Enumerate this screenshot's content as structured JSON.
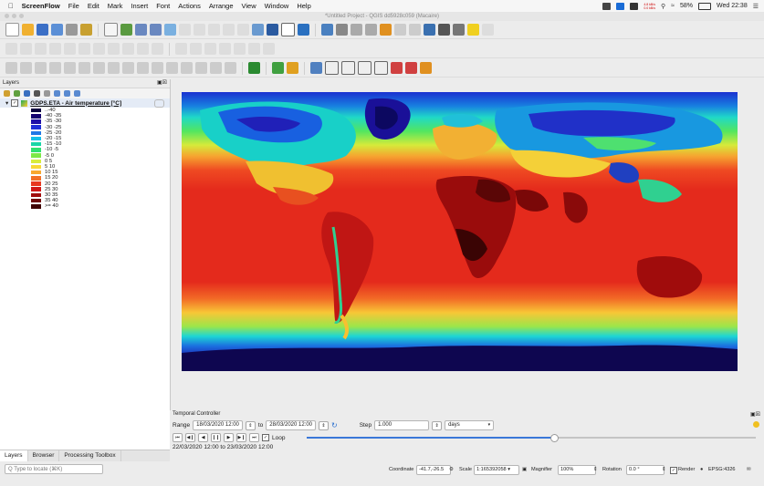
{
  "menubar": {
    "app": "ScreenFlow",
    "items": [
      "File",
      "Edit",
      "Mark",
      "Insert",
      "Font",
      "Actions",
      "Arrange",
      "View",
      "Window",
      "Help"
    ],
    "battery": "58%",
    "clock": "Wed 22:38",
    "net_up": "4.8 kB/s",
    "net_down": "0.0 kB/s"
  },
  "window": {
    "title": "*Untitled Project - QGIS dd5928c059 (Macaire)"
  },
  "layers_panel": {
    "title": "Layers",
    "layer_name": "GDPS.ETA - Air temperature [°C]",
    "legend": [
      {
        "label": "..-40",
        "color": "#0b0040"
      },
      {
        "label": "-40 -35",
        "color": "#140070"
      },
      {
        "label": "-35 -30",
        "color": "#1f10a8"
      },
      {
        "label": "-30 -25",
        "color": "#2030d8"
      },
      {
        "label": "-25 -20",
        "color": "#1f78e6"
      },
      {
        "label": "-20 -15",
        "color": "#15c0e8"
      },
      {
        "label": "-15 -10",
        "color": "#18d6a6"
      },
      {
        "label": "-10 -5",
        "color": "#2fe070"
      },
      {
        "label": "-5 0",
        "color": "#7de845"
      },
      {
        "label": "0 5",
        "color": "#d8ec3c"
      },
      {
        "label": "5 10",
        "color": "#f8d838"
      },
      {
        "label": "10 15",
        "color": "#f8a830"
      },
      {
        "label": "15 20",
        "color": "#f27028"
      },
      {
        "label": "20 25",
        "color": "#e83820"
      },
      {
        "label": "25 30",
        "color": "#d01818"
      },
      {
        "label": "30 35",
        "color": "#a00c0c"
      },
      {
        "label": "35 40",
        "color": "#700808"
      },
      {
        "label": ">= 40",
        "color": "#400404"
      }
    ]
  },
  "tabs": [
    "Layers",
    "Browser",
    "Processing Toolbox"
  ],
  "locate_placeholder": "Q  Type to locate (⌘K)",
  "temporal": {
    "title": "Temporal Controller",
    "range_label": "Range",
    "start": "18/03/2020 12:00",
    "to_label": "to",
    "end": "28/03/2020 12:00",
    "step_label": "Step",
    "step_value": "1.000",
    "step_unit": "days",
    "loop_label": "Loop",
    "current_range": "22/03/2020 12:00 to 23/03/2020 12:00",
    "slider_position": 0.55
  },
  "status": {
    "coordinate_label": "Coordinate",
    "coordinate": "-41.7,-26.5",
    "scale_label": "Scale",
    "scale": "1:165392058",
    "magnifier_label": "Magnifier",
    "magnifier": "100%",
    "rotation_label": "Rotation",
    "rotation": "0.0 °",
    "render_label": "Render",
    "crs": "EPSG:4326"
  }
}
